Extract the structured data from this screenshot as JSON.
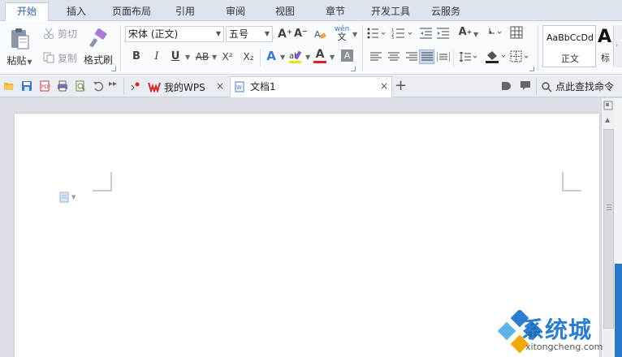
{
  "menu": {
    "tabs": [
      {
        "label": "开始",
        "active": true
      },
      {
        "label": "插入"
      },
      {
        "label": "页面布局"
      },
      {
        "label": "引用"
      },
      {
        "label": "审阅"
      },
      {
        "label": "视图"
      },
      {
        "label": "章节"
      },
      {
        "label": "开发工具"
      },
      {
        "label": "云服务"
      }
    ]
  },
  "ribbon": {
    "clipboard": {
      "paste_label": "粘贴",
      "cut_label": "剪切",
      "copy_label": "复制",
      "format_painter_label": "格式刷"
    },
    "font": {
      "font_name": "宋体 (正文)",
      "font_size": "五号",
      "bold": "B",
      "italic": "I",
      "underline": "U",
      "strikethrough": "AB",
      "superscript": "X²",
      "subscript": "X₂",
      "grow": "A⁺",
      "shrink": "A⁻",
      "text_effect": "A",
      "highlight": "ab",
      "font_color": "A",
      "char_shading": "A",
      "phonetic": "wén"
    },
    "styles": {
      "sample_text": "AaBbCcDd",
      "style_name": "正文",
      "next_sample": "A",
      "next_name": "标"
    }
  },
  "quickbar": {
    "tabs": [
      {
        "label": "我的WPS",
        "icon": "wps-logo-icon"
      },
      {
        "label": "文档1",
        "icon": "document-icon",
        "active": true
      }
    ],
    "add_tab": "+",
    "search_label": "点此查找命令"
  },
  "watermark": {
    "text": "系统城",
    "url": "xitongcheng.com"
  },
  "colors": {
    "accent": "#2b5fb3",
    "menubar": "#dde4ee",
    "watermark_blue": "#2c7fd0",
    "wps_red": "#d9262c"
  }
}
